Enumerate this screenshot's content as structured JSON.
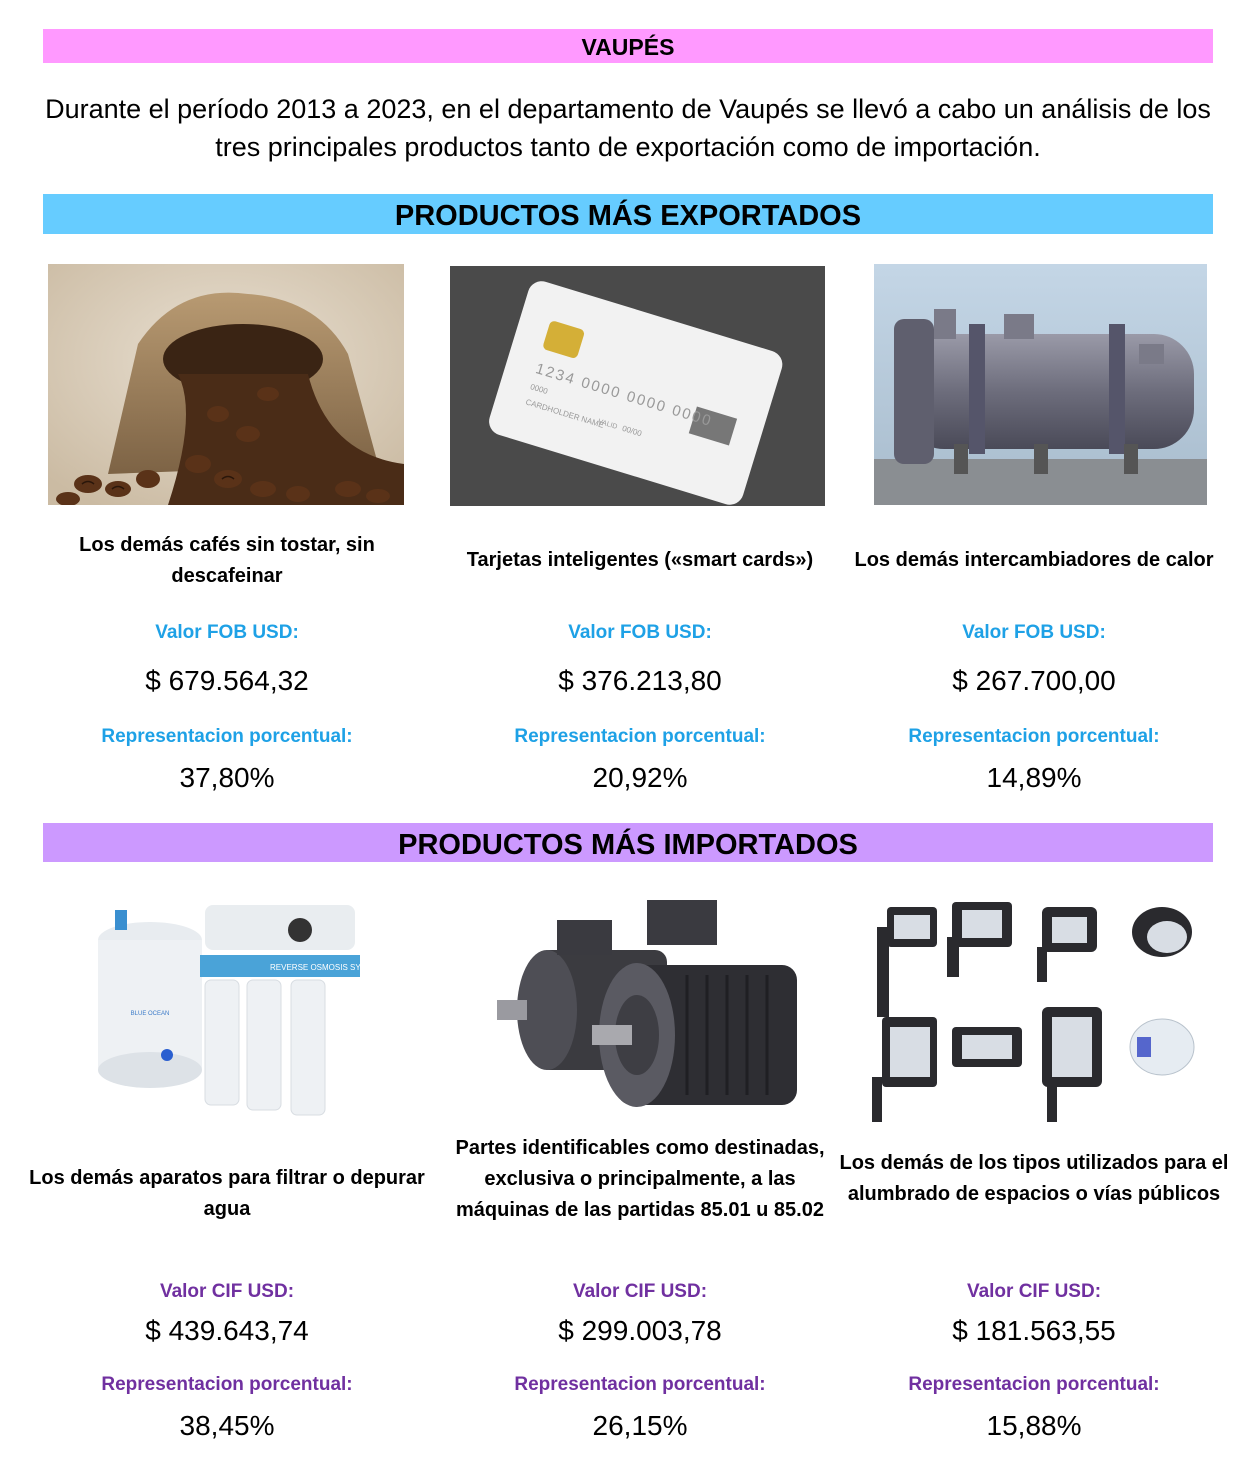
{
  "header": {
    "title": "VAUPÉS",
    "intro": "Durante el período 2013 a 2023, en el departamento de Vaupés se llevó a cabo un análisis de los tres principales productos tanto de exportación como de importación."
  },
  "exports": {
    "title": "PRODUCTOS MÁS EXPORTADOS",
    "value_label": "Valor FOB USD:",
    "share_label": "Representacion porcentual:",
    "items": [
      {
        "name": "Los demás cafés sin tostar, sin descafeinar",
        "value": "$ 679.564,32",
        "share": "37,80%",
        "image": "coffee-beans-sack"
      },
      {
        "name": "Tarjetas inteligentes («smart cards»)",
        "value": "$ 376.213,80",
        "share": "20,92%",
        "image": "smart-card",
        "card_number": "1234 0000 0000 0000",
        "card_small": "0000",
        "card_valid": "VALID",
        "card_date": "00/00",
        "card_holder": "CARDHOLDER NAME"
      },
      {
        "name": "Los demás intercambiadores de calor",
        "value": "$ 267.700,00",
        "share": "14,89%",
        "image": "heat-exchanger"
      }
    ]
  },
  "imports": {
    "title": "PRODUCTOS MÁS IMPORTADOS",
    "value_label": "Valor CIF USD:",
    "share_label": "Representacion porcentual:",
    "items": [
      {
        "name": "Los demás aparatos para filtrar o depurar agua",
        "value": "$ 439.643,74",
        "share": "38,45%",
        "image": "reverse-osmosis-filter",
        "brand": "BLUE OCEAN",
        "strip_text": "REVERSE OSMOSIS SYSTEM"
      },
      {
        "name": "Partes identificables como destinadas, exclusiva o principalmente, a las máquinas de las partidas 85.01 u 85.02",
        "value": "$ 299.003,78",
        "share": "26,15%",
        "image": "electric-motors"
      },
      {
        "name": "Los demás de los tipos utilizados para el alumbrado de espacios o vías públicos",
        "value": "$ 181.563,55",
        "share": "15,88%",
        "image": "street-lights"
      }
    ]
  }
}
